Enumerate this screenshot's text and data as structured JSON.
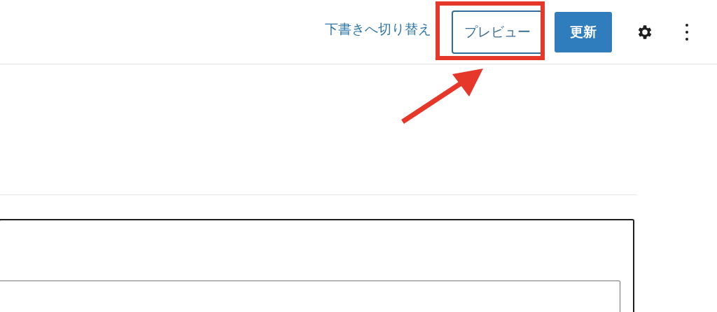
{
  "header": {
    "switch_to_draft": "下書きへ切り替え",
    "preview_button": "プレビュー",
    "update_button": "更新"
  }
}
